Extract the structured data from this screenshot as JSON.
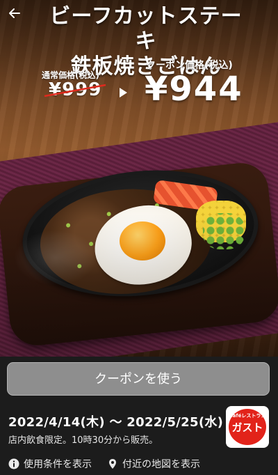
{
  "header": {
    "title_line1": "ビーフカットステーキ",
    "title_line2": "鉄板焼きごはん",
    "back_icon": "back-arrow-icon"
  },
  "pricing": {
    "regular_label": "通常価格(税込)",
    "regular_price": "¥999",
    "coupon_label": "クーポン価格(税込)",
    "coupon_price": "¥944"
  },
  "coupon": {
    "use_button_label": "クーポンを使う",
    "period": "2022/4/14(木) ～ 2022/5/25(水)",
    "note": "店内飲食限定。10時30分から販売。"
  },
  "brand": {
    "logo_top": "Caféレストラン",
    "logo_name": "ガスト",
    "color": "#e2231a"
  },
  "links": {
    "terms_label": "使用条件を表示",
    "terms_icon": "info-icon",
    "map_label": "付近の地図を表示",
    "map_icon": "location-pin-icon"
  }
}
